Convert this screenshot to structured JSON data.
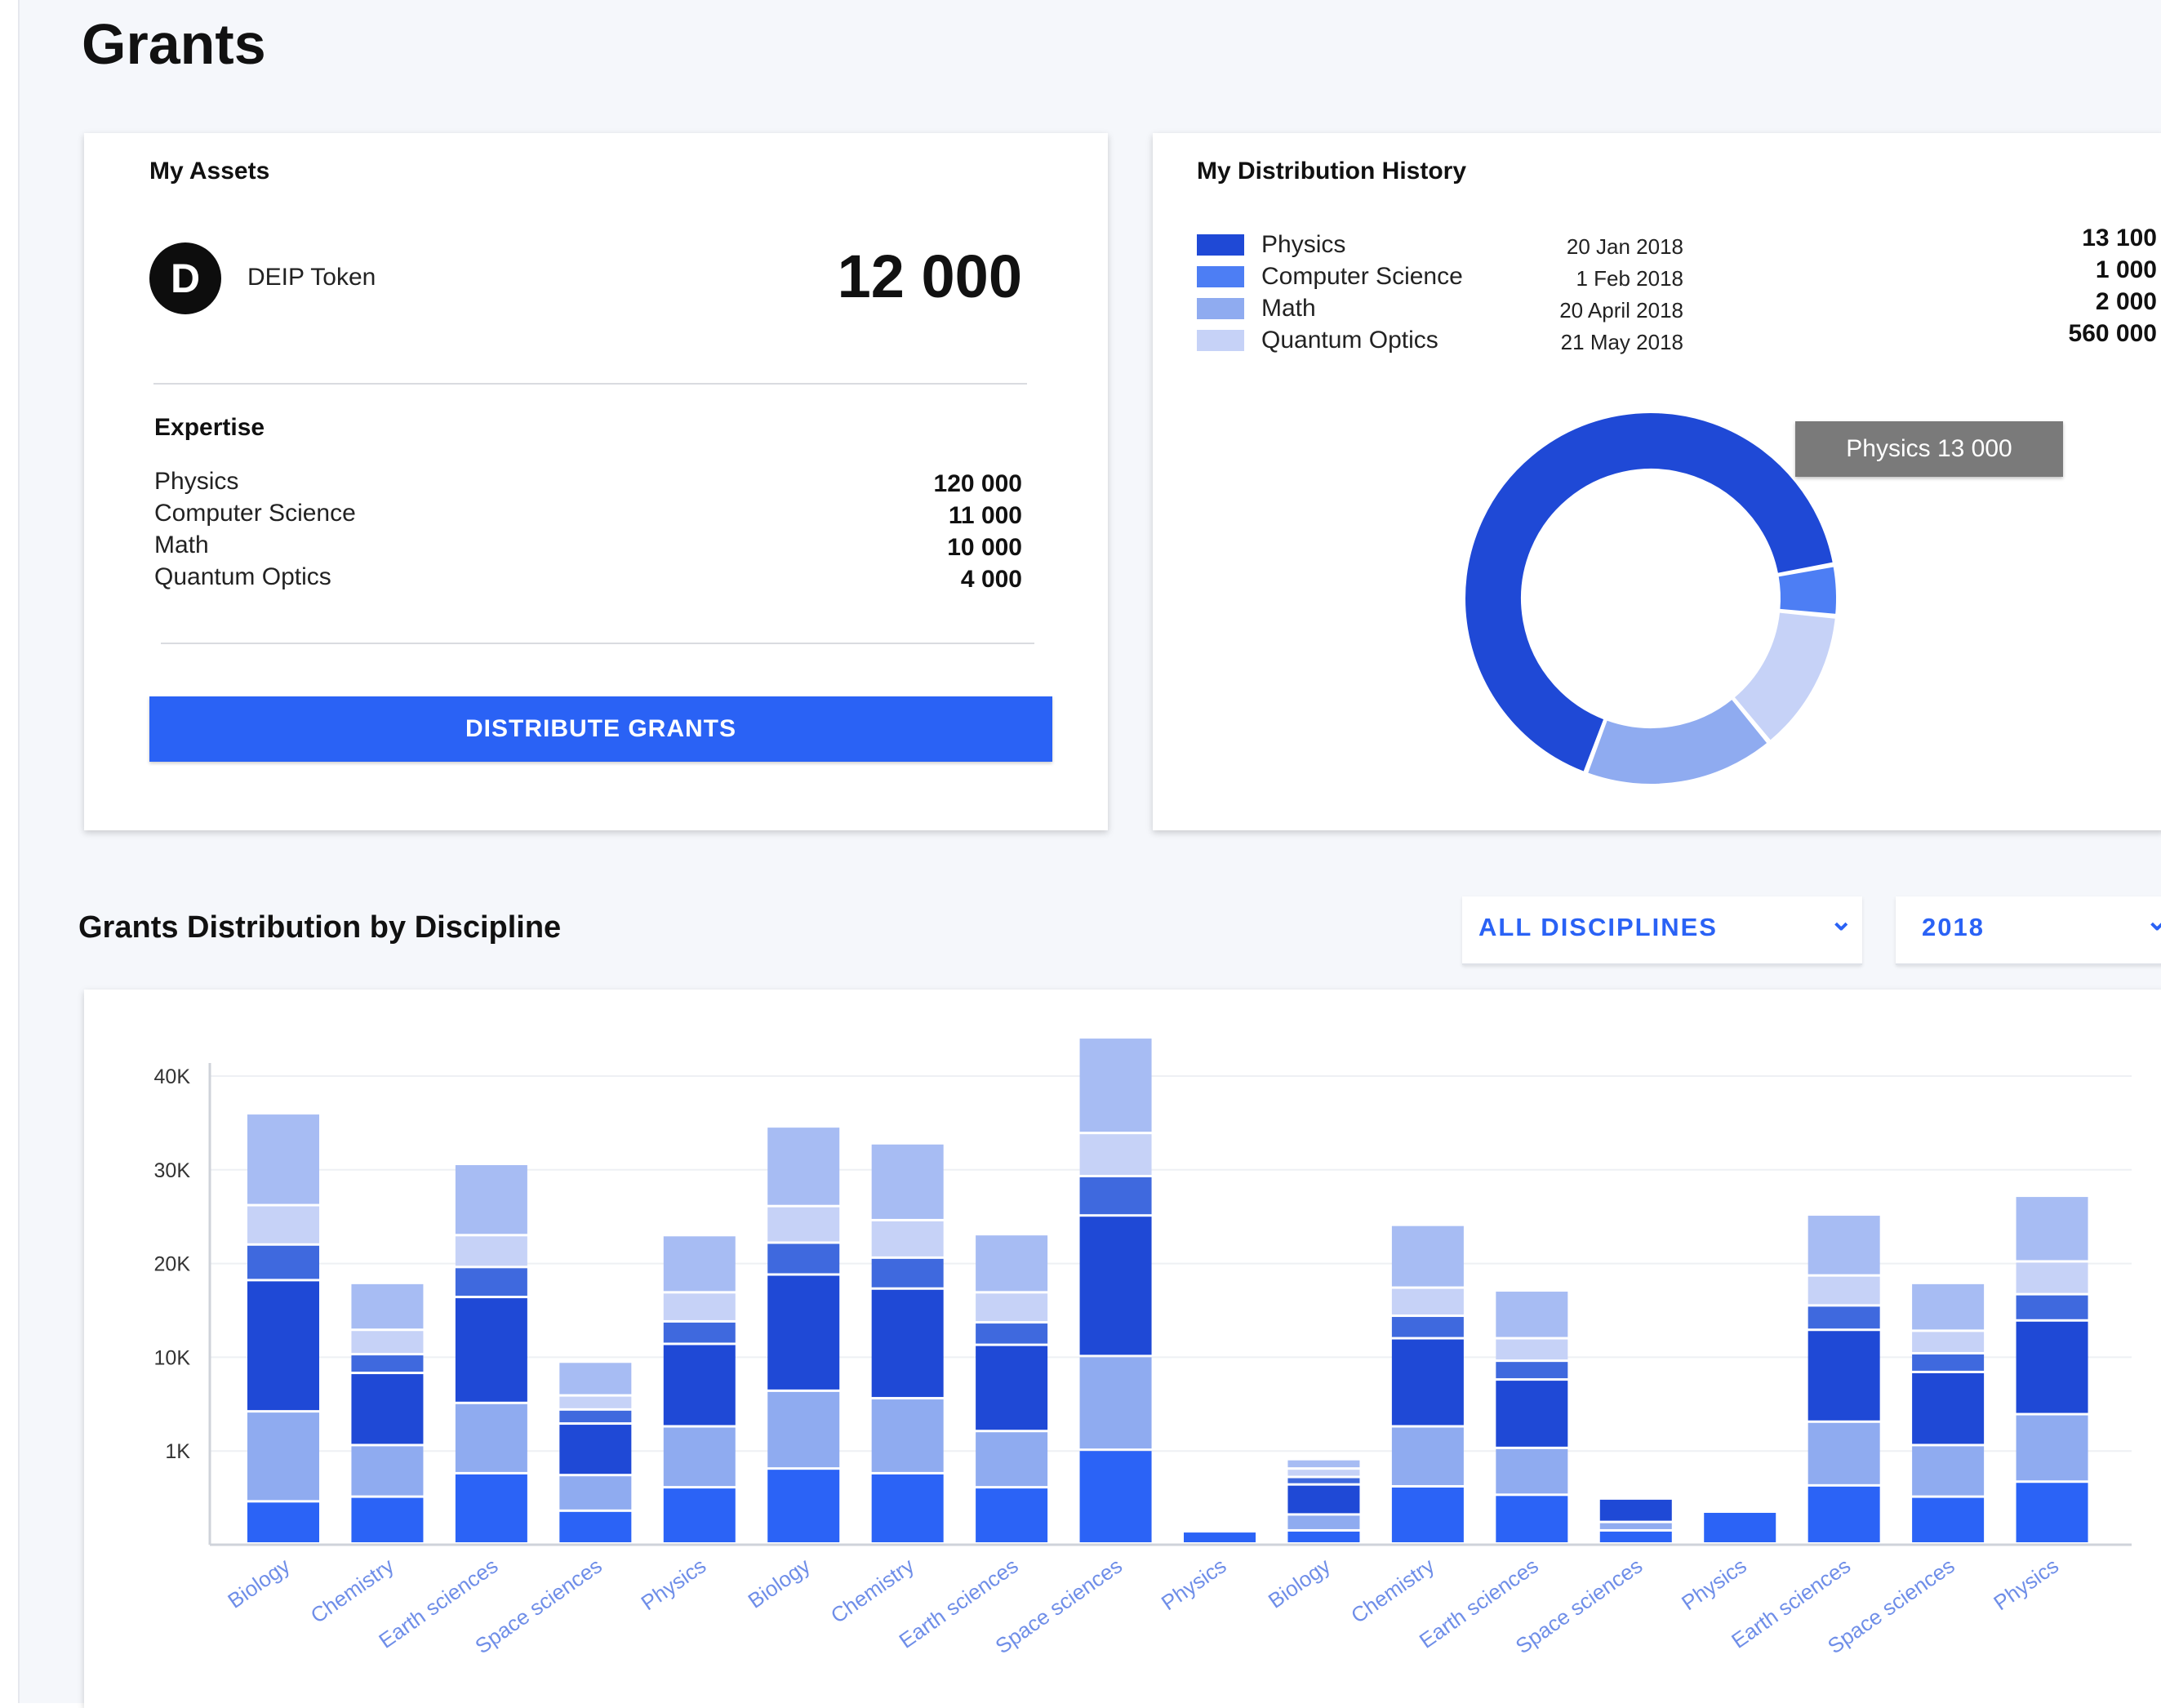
{
  "page": {
    "title": "Grants"
  },
  "assets": {
    "title": "My Assets",
    "token_name": "DEIP Token",
    "token_icon_letter": "D",
    "token_amount": "12 000",
    "expertise_title": "Expertise",
    "expertise": [
      {
        "label": "Physics",
        "value": "120 000"
      },
      {
        "label": "Computer Science",
        "value": "11 000"
      },
      {
        "label": "Math",
        "value": "10 000"
      },
      {
        "label": "Quantum Optics",
        "value": "4 000"
      }
    ],
    "distribute_label": "DISTRIBUTE GRANTS"
  },
  "history": {
    "title": "My Distribution History",
    "legend": [
      {
        "label": "Physics",
        "color": "#1f49d6"
      },
      {
        "label": "Computer Science",
        "color": "#4d7ef4"
      },
      {
        "label": "Math",
        "color": "#8fabf0"
      },
      {
        "label": "Quantum Optics",
        "color": "#c6d2f7"
      }
    ],
    "entries": [
      {
        "date": "20 Jan 2018",
        "amount": "13 100"
      },
      {
        "date": "1 Feb 2018",
        "amount": "1 000"
      },
      {
        "date": "20 April 2018",
        "amount": "2 000"
      },
      {
        "date": "21 May 2018",
        "amount": "560 000"
      }
    ],
    "tooltip": "Physics 13 000"
  },
  "distribution": {
    "title": "Grants Distribution by Discipline",
    "discipline_filter": "ALL DISCIPLINES",
    "year_filter": "2018"
  },
  "colors": {
    "accent": "#2a62f5",
    "physics": "#1f49d6",
    "computer_science": "#4d7ef4",
    "math": "#8fabf0",
    "quantum_optics": "#c6d2f7"
  },
  "chart_data": {
    "type": "bar",
    "stacked": true,
    "categories": [
      "Biology",
      "Chemistry",
      "Earth sciences",
      "Space sciences",
      "Physics",
      "Biology",
      "Chemistry",
      "Earth sciences",
      "Space sciences",
      "Physics",
      "Biology",
      "Chemistry",
      "Earth sciences",
      "Space sciences",
      "Physics",
      "Earth sciences",
      "Space sciences",
      "Physics"
    ],
    "yticks": [
      "1K",
      "10K",
      "20K",
      "30K",
      "40K"
    ],
    "ylim": [
      -10000,
      40000
    ],
    "grid": true,
    "stack_colors": [
      "#2b63f6",
      "#8fabf0",
      "#1f49d6",
      "#3f69de",
      "#c6d2f7",
      "#a7bcf3"
    ],
    "series": [
      {
        "values": [
          -5500,
          -5000,
          -2500,
          -6500,
          -4000,
          -2000,
          -2500,
          -4000,
          0,
          -8700,
          -8600,
          -3900,
          -4800,
          -8600,
          -6600,
          -3800,
          -5000,
          -3400
        ]
      },
      {
        "values": [
          9600,
          5500,
          7500,
          3800,
          6500,
          8300,
          8000,
          6000,
          10000,
          0,
          1700,
          6400,
          5000,
          900,
          0,
          6800,
          5500,
          7200
        ]
      },
      {
        "values": [
          14000,
          7700,
          11300,
          5500,
          8800,
          12400,
          11700,
          9200,
          15000,
          0,
          3200,
          9400,
          7300,
          2500,
          0,
          9800,
          7800,
          10000
        ]
      },
      {
        "values": [
          3800,
          2000,
          3200,
          1500,
          2400,
          3400,
          3300,
          2400,
          4200,
          0,
          800,
          2400,
          2000,
          0,
          0,
          2600,
          2000,
          2800
        ]
      },
      {
        "values": [
          4200,
          2600,
          3400,
          1500,
          3100,
          3900,
          4000,
          3200,
          4600,
          0,
          900,
          3000,
          2400,
          0,
          0,
          3200,
          2400,
          3500
        ]
      },
      {
        "values": [
          9800,
          5000,
          7600,
          3600,
          6100,
          8500,
          8200,
          6200,
          10200,
          0,
          1000,
          6700,
          5100,
          0,
          0,
          6500,
          5100,
          7000
        ]
      }
    ]
  }
}
